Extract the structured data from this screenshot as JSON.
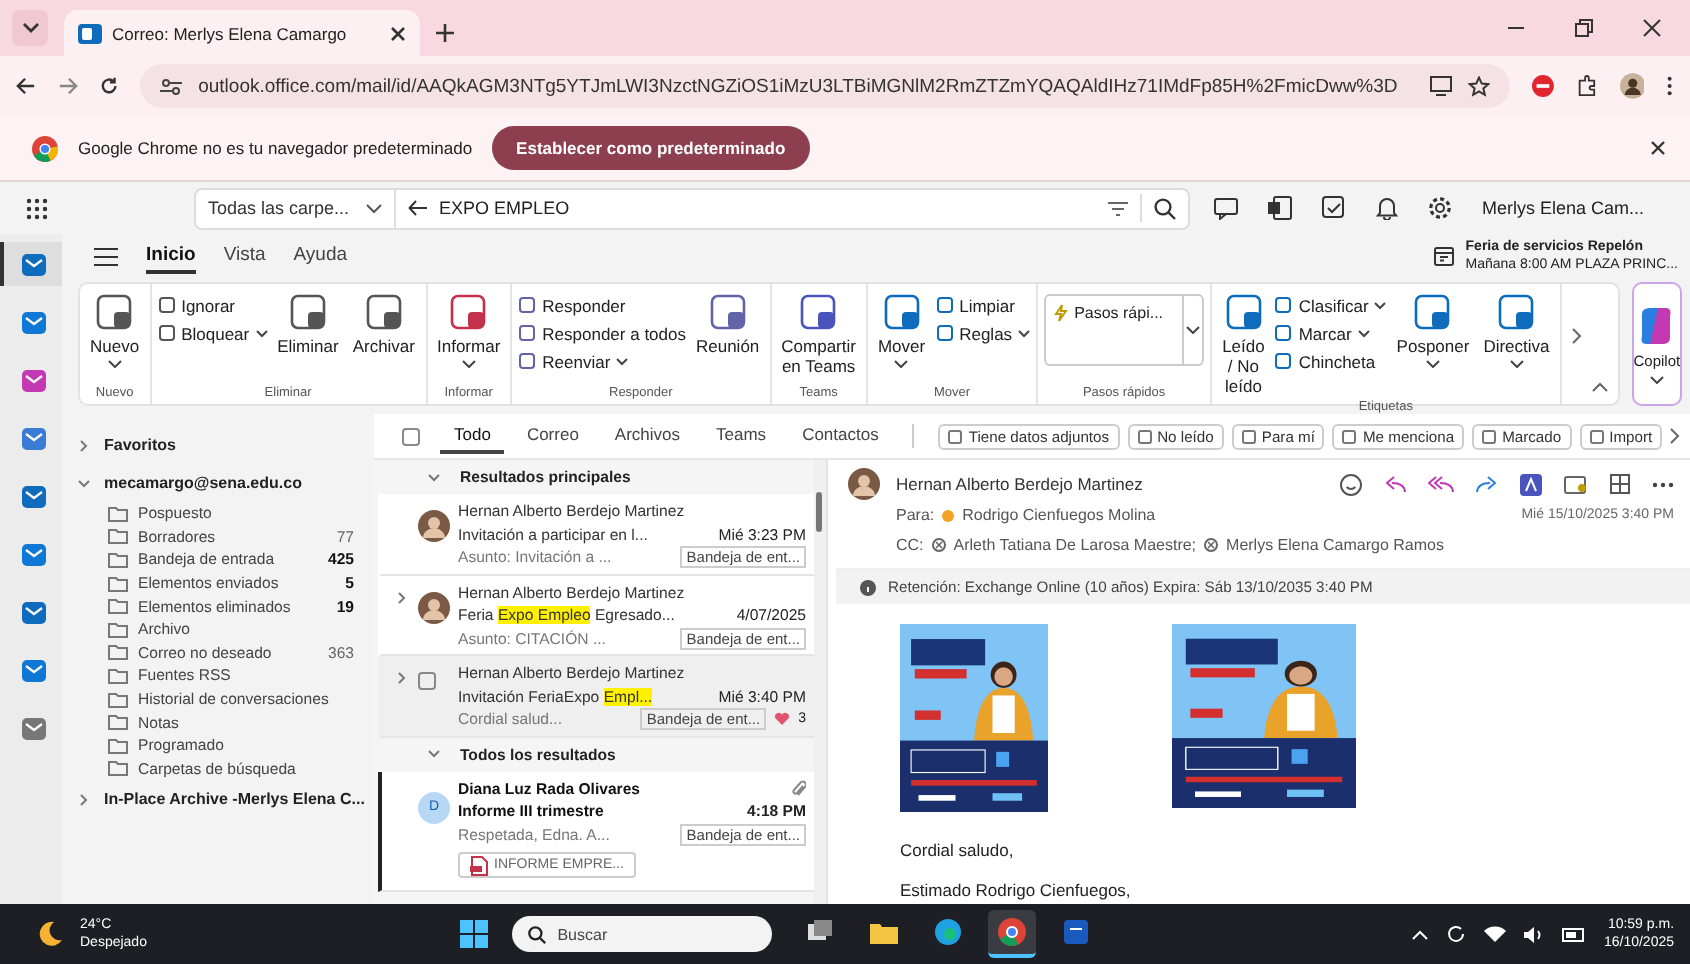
{
  "browser": {
    "tab_title": "Correo: Merlys Elena Camargo",
    "url": "outlook.office.com/mail/id/AAQkAGM3NTg5YTJmLWI3NzctNGZiOS1iMzU3LTBiMGNlM2RmZTZmYQAQAldIHz71IMdFp85H%2FmicDww%3D",
    "info_text": "Google Chrome no es tu navegador predeterminado",
    "info_button": "Establecer como predeterminado"
  },
  "header": {
    "scope": "Todas las carpe...",
    "query": "EXPO EMPLEO",
    "user": "Merlys Elena Cam..."
  },
  "rail": [
    {
      "selected": true
    },
    {
      "selected": false
    },
    {
      "selected": false
    },
    {
      "selected": false
    },
    {
      "selected": false
    },
    {
      "selected": false
    },
    {
      "selected": false
    },
    {
      "selected": false
    },
    {
      "selected": false
    }
  ],
  "nav_tabs": [
    {
      "label": "Inicio",
      "selected": true
    },
    {
      "label": "Vista",
      "selected": false
    },
    {
      "label": "Ayuda",
      "selected": false
    }
  ],
  "reminder": {
    "title": "Feria de servicios Repelón",
    "detail": "Mañana 8:00 AM PLAZA PRINC..."
  },
  "ribbon": [
    {
      "label": "Nuevo",
      "columns": [
        {
          "kind": "large",
          "label": "Nuevo",
          "dropdown": true
        }
      ]
    },
    {
      "label": "Eliminar",
      "columns": [
        {
          "kind": "stack",
          "items": [
            {
              "label": "Ignorar",
              "dropdown": false
            },
            {
              "label": "Bloquear",
              "dropdown": true
            }
          ]
        },
        {
          "kind": "large",
          "label": "Eliminar",
          "dropdown": false
        },
        {
          "kind": "large",
          "label": "Archivar",
          "dropdown": false
        }
      ]
    },
    {
      "label": "Informar",
      "columns": [
        {
          "kind": "large",
          "label": "Informar",
          "dropdown": true
        }
      ]
    },
    {
      "label": "Responder",
      "columns": [
        {
          "kind": "stack",
          "items": [
            {
              "label": "Responder",
              "dropdown": false
            },
            {
              "label": "Responder a todos",
              "dropdown": false
            },
            {
              "label": "Reenviar",
              "dropdown": true
            }
          ]
        },
        {
          "kind": "large",
          "label": "Reunión",
          "dropdown": false
        }
      ]
    },
    {
      "label": "Teams",
      "columns": [
        {
          "kind": "large",
          "label": "Compartir en Teams",
          "dropdown": false
        }
      ]
    },
    {
      "label": "Mover",
      "columns": [
        {
          "kind": "large",
          "label": "Mover",
          "dropdown": true
        },
        {
          "kind": "stack",
          "items": [
            {
              "label": "Limpiar",
              "dropdown": false
            },
            {
              "label": "Reglas",
              "dropdown": true
            }
          ]
        }
      ]
    },
    {
      "label": "Pasos rápidos",
      "columns": [
        {
          "kind": "gallery",
          "label": "Pasos rápi..."
        }
      ]
    },
    {
      "label": "Etiquetas",
      "columns": [
        {
          "kind": "large",
          "label": "Leído / No leído",
          "dropdown": false
        },
        {
          "kind": "stack",
          "items": [
            {
              "label": "Clasificar",
              "dropdown": true
            },
            {
              "label": "Marcar",
              "dropdown": true
            },
            {
              "label": "Chincheta",
              "dropdown": false
            }
          ]
        },
        {
          "kind": "large",
          "label": "Posponer",
          "dropdown": true
        },
        {
          "kind": "large",
          "label": "Directiva",
          "dropdown": true
        }
      ]
    }
  ],
  "copilot": "Copilot",
  "folder_groups": [
    {
      "label": "Favoritos",
      "expanded": false
    },
    {
      "label": "mecamargo@sena.edu.co",
      "expanded": true,
      "children": [
        {
          "label": "Pospuesto"
        },
        {
          "label": "Borradores",
          "count": "77",
          "emphasized": false
        },
        {
          "label": "Bandeja de entrada",
          "count": "425",
          "emphasized": true
        },
        {
          "label": "Elementos enviados",
          "count": "5",
          "emphasized": true
        },
        {
          "label": "Elementos eliminados",
          "count": "19",
          "emphasized": true
        },
        {
          "label": "Archivo"
        },
        {
          "label": "Correo no deseado",
          "count": "363",
          "emphasized": false
        },
        {
          "label": "Fuentes RSS"
        },
        {
          "label": "Historial de conversaciones"
        },
        {
          "label": "Notas"
        },
        {
          "label": "Programado"
        },
        {
          "label": "Carpetas de búsqueda"
        }
      ]
    },
    {
      "label": "In-Place Archive -Merlys Elena C...",
      "expanded": false
    }
  ],
  "filter": {
    "select_all_checked": false,
    "tabs": [
      {
        "label": "Todo",
        "selected": true
      },
      {
        "label": "Correo",
        "selected": false
      },
      {
        "label": "Archivos",
        "selected": false
      },
      {
        "label": "Teams",
        "selected": false
      },
      {
        "label": "Contactos",
        "selected": false
      }
    ],
    "chips": [
      "Tiene datos adjuntos",
      "No leído",
      "Para mí",
      "Me menciona",
      "Marcado",
      "Import"
    ]
  },
  "sections": [
    {
      "title": "Resultados principales",
      "expanded": true,
      "messages": [
        {
          "sender": "Hernan Alberto Berdejo Martinez",
          "subject": [
            {
              "text": "Invitación a participar en l...",
              "highlighted": false
            }
          ],
          "date": "Mié 3:23 PM",
          "preview": "Asunto: Invitación a ...",
          "folder": "Bandeja de ent...",
          "has_thread": false,
          "unread": false,
          "selected": false,
          "focused": false
        },
        {
          "sender": "Hernan Alberto Berdejo Martinez",
          "subject": [
            {
              "text": "Feria ",
              "highlighted": false
            },
            {
              "text": "Expo Empleo",
              "highlighted": true
            },
            {
              "text": " Egresado...",
              "highlighted": false
            }
          ],
          "date": "4/07/2025",
          "preview": "Asunto: CITACIÓN ...",
          "folder": "Bandeja de ent...",
          "has_thread": true,
          "unread": false,
          "selected": false,
          "focused": false
        },
        {
          "kind": "checkbox",
          "sender": "Hernan Alberto Berdejo Martinez",
          "subject": [
            {
              "text": "Invitación FeriaExpo ",
              "highlighted": false
            },
            {
              "text": "Empl...",
              "highlighted": true
            }
          ],
          "date": "Mié 3:40 PM",
          "preview": "Cordial salud...",
          "folder": "Bandeja de ent...",
          "reaction": "3",
          "has_thread": true,
          "unread": false,
          "selected": true,
          "focused": false
        }
      ]
    },
    {
      "title": "Todos los resultados",
      "expanded": true,
      "messages": [
        {
          "kind": "initial",
          "initial": "D",
          "sender": "Diana Luz Rada Olivares",
          "subject": [
            {
              "text": "Informe III trimestre",
              "highlighted": false
            }
          ],
          "date": "4:18 PM",
          "preview": "Respetada, Edna. A...",
          "folder": "Bandeja de ent...",
          "attachment": "INFORME EMPRE...",
          "has_thread": false,
          "unread": true,
          "selected": false,
          "focused": true
        }
      ]
    }
  ],
  "reading": {
    "sender": "Hernan Alberto Berdejo Martinez",
    "to_label": "Para:",
    "to": "Rodrigo Cienfuegos Molina",
    "cc_label": "CC:",
    "cc": [
      "Arleth Tatiana De Larosa Maestre;",
      "Merlys Elena Camargo Ramos"
    ],
    "date": "Mié 15/10/2025 3:40 PM",
    "retention": "Retención: Exchange Online (10 años) Expira: Sáb 13/10/2035 3:40 PM",
    "images": [
      {
        "kind": "picture"
      },
      {
        "kind": "picture"
      }
    ],
    "body": [
      "Cordial saludo,",
      "Estimado Rodrigo Cienfuegos,"
    ]
  },
  "taskbar": {
    "temperature": "24°C",
    "weather": "Despejado",
    "search_placeholder": "Buscar",
    "apps": [
      {
        "active": false
      },
      {
        "active": false
      },
      {
        "active": false
      },
      {
        "active": true
      },
      {
        "active": false
      }
    ],
    "time": "10:59 p.m.",
    "date": "16/10/2025"
  }
}
